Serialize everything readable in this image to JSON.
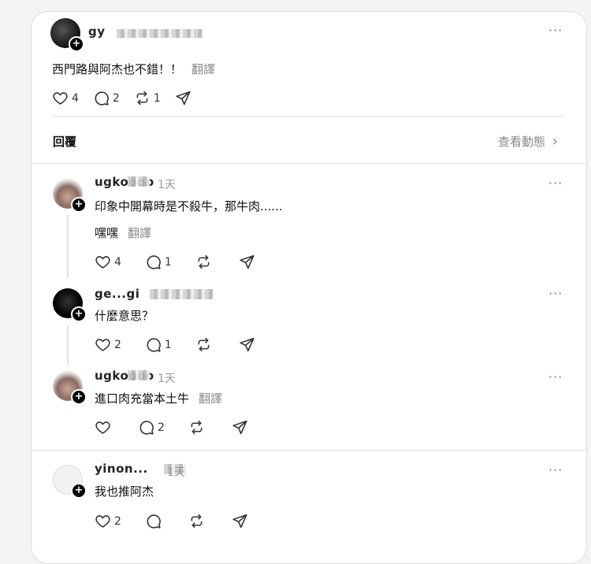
{
  "post": {
    "username": "gy",
    "text": "西門路與阿杰也不錯！！",
    "translate": "翻譯",
    "likes": "4",
    "comments": "2",
    "reposts": "1"
  },
  "replies_bar": {
    "label": "回覆",
    "view_activity": "查看動態",
    "arrow": "›"
  },
  "comments": [
    {
      "username": "ugkoooo",
      "time": "1天",
      "text": "印象中開幕時是不殺牛，那牛肉......",
      "extra": "嘿嘿",
      "translate": "翻譯",
      "likes": "4",
      "comments": "1",
      "reposts": ""
    },
    {
      "username": "ge...gi",
      "time": "",
      "text": "什麼意思？",
      "likes": "2",
      "comments": "1",
      "reposts": ""
    },
    {
      "username": "ugkoooo",
      "time": "1天",
      "text": "進口肉充當本土牛",
      "translate": "翻譯",
      "likes": "",
      "comments": "2",
      "reposts": ""
    },
    {
      "username": "yinon...",
      "time": "1天",
      "text": "我也推阿杰",
      "likes": "2",
      "comments": "",
      "reposts": ""
    }
  ],
  "icons": {
    "more": "more-horizontal-icon",
    "like": "heart-icon",
    "comment": "comment-icon",
    "repost": "repost-icon",
    "share": "send-icon",
    "follow": "plus-icon"
  }
}
